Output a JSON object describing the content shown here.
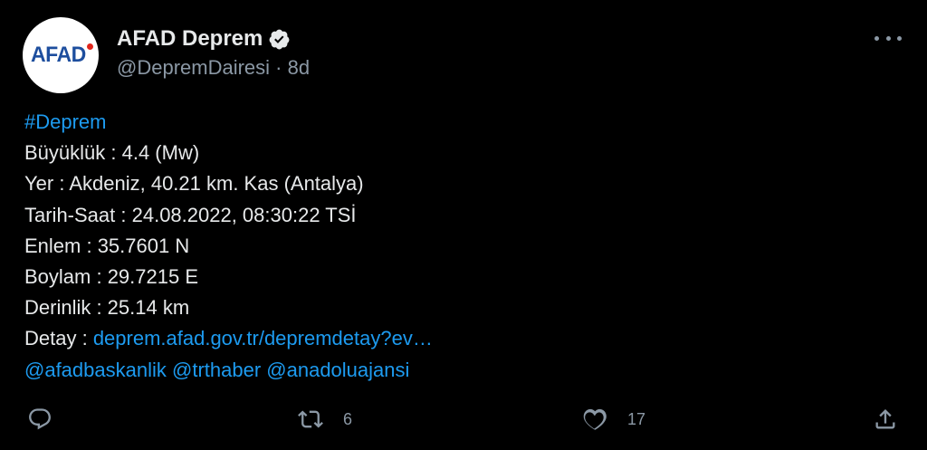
{
  "account": {
    "display_name": "AFAD Deprem",
    "handle": "@DepremDairesi",
    "separator": "·",
    "time": "8d",
    "avatar_text": "AFAD",
    "verified": true
  },
  "tweet": {
    "hashtag": "#Deprem",
    "lines": [
      "Büyüklük : 4.4 (Mw)",
      "Yer : Akdeniz, 40.21 km. Kas (Antalya)",
      "Tarih-Saat : 24.08.2022, 08:30:22 TSİ",
      "Enlem : 35.7601 N",
      "Boylam : 29.7215 E",
      "Derinlik : 25.14 km"
    ],
    "detail_label": "Detay : ",
    "detail_link": "deprem.afad.gov.tr/depremdetay?ev…",
    "mentions": [
      "@afadbaskanlik",
      "@trthaber",
      "@anadoluajansi"
    ]
  },
  "actions": {
    "reply_count": "",
    "retweet_count": "6",
    "like_count": "17"
  },
  "colors": {
    "background": "#000000",
    "text": "#e7e9ea",
    "secondary": "#8b98a5",
    "link": "#1d9bf0",
    "afad_blue": "#1d4e9e",
    "afad_red": "#e1251b"
  },
  "icons": {
    "more": "more-dots-icon",
    "verified": "verified-badge-icon",
    "reply": "reply-icon",
    "retweet": "retweet-icon",
    "like": "heart-icon",
    "share": "share-icon"
  }
}
